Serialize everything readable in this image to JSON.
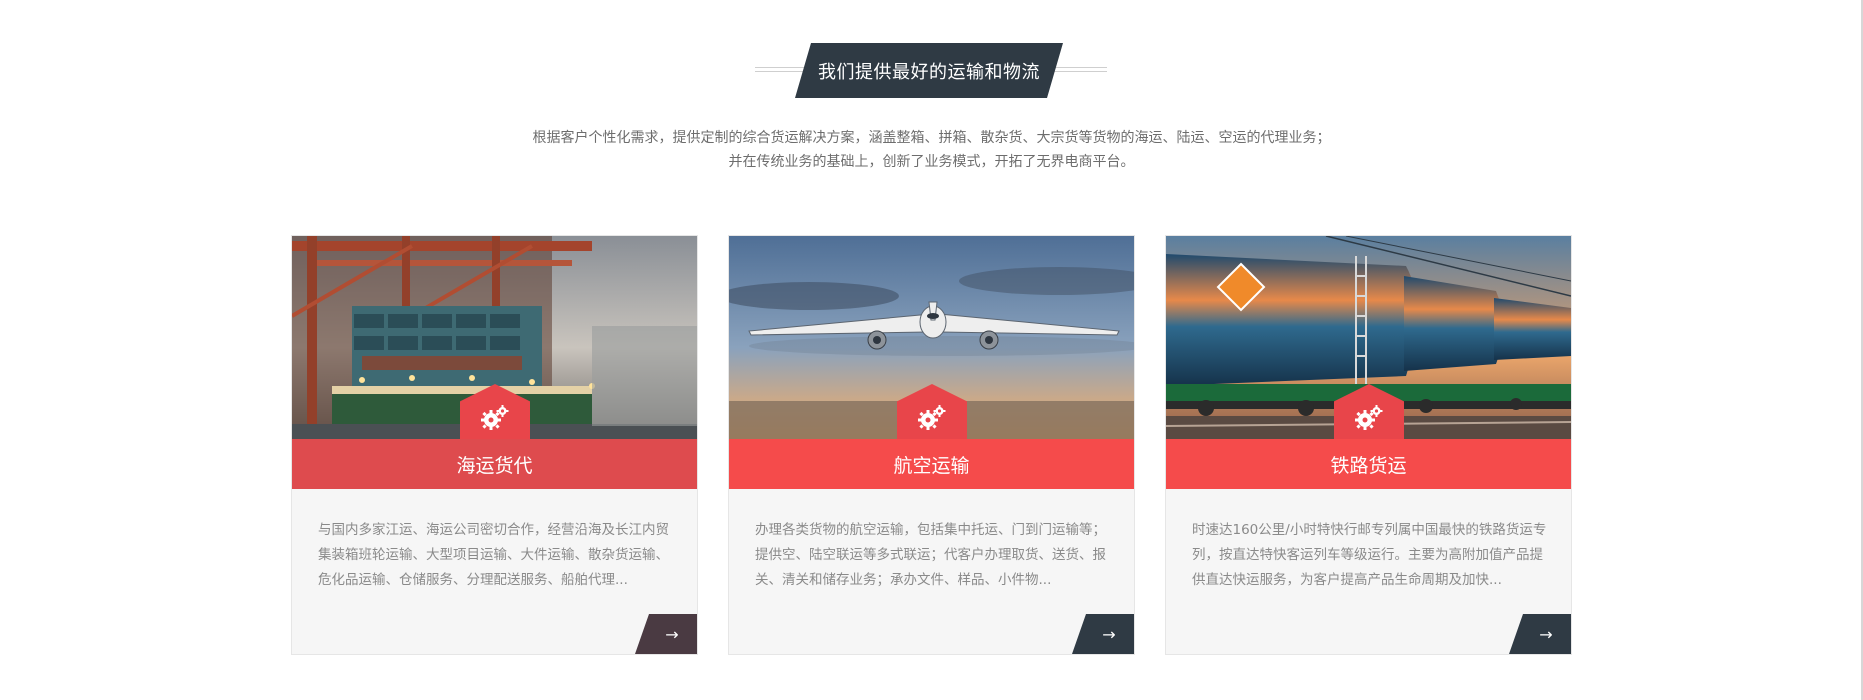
{
  "section": {
    "title": "我们提供最好的运输和物流",
    "intro_line1": "根据客户个性化需求，提供定制的综合货运解决方案，涵盖整箱、拼箱、散杂货、大宗货等货物的海运、陆运、空运的代理业务；",
    "intro_line2": "并在传统业务的基础上，创新了业务模式，开拓了无界电商平台。"
  },
  "cards": [
    {
      "title": "海运货代",
      "description": "与国内多家江运、海运公司密切合作，经营沿海及长江内贸集装箱班轮运输、大型项目运输、大件运输、散杂货运输、危化品运输、仓储服务、分理配送服务、船舶代理...",
      "icon": "gears-icon",
      "arrow": "→",
      "image": "container-ship-port"
    },
    {
      "title": "航空运输",
      "description": "办理各类货物的航空运输，包括集中托运、门到门运输等；提供空、陆空联运等多式联运；代客户办理取货、送货、报关、清关和储存业务；承办文件、样品、小件物...",
      "icon": "gears-icon",
      "arrow": "→",
      "image": "airplane-landing"
    },
    {
      "title": "铁路货运",
      "description": "时速达160公里/小时特快行邮专列属中国最快的铁路货运专列，按直达特快客运列车等级运行。主要为高附加值产品提供直达快运服务，为客户提高产品生命周期及加快...",
      "icon": "gears-icon",
      "arrow": "→",
      "image": "tanker-train"
    }
  ],
  "colors": {
    "title_plate": "#2f3a44",
    "accent_red": "#f54b4b",
    "card_bg": "#f6f6f6"
  }
}
